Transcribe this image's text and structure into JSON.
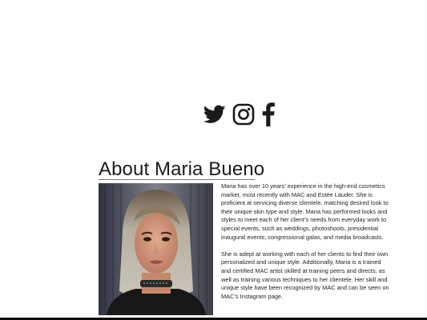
{
  "social": {
    "icons": [
      "twitter-icon",
      "instagram-icon",
      "facebook-icon"
    ],
    "icon_color": "#1b1b1b"
  },
  "about": {
    "title": "About Maria Bueno",
    "paragraphs": [
      "Maria has over 10 years’ experience in the high-end cosmetics market, most recently with MAC and Estée Lauder. She is proficient at servicing diverse clientele, matching desired look to their unique skin type and style. Maria has performed looks and styles to meet each of her client’s needs from everyday work to special events, such as weddings, photoshoots, presidential inaugural events, congressional galas, and media broadcasts.",
      "She is adept at working with each of her clients to find their own personalized and unique style. Additionally, Maria is a trained and certified MAC artist skilled at training peers and directs, as well as training various techniques to her clientele. Her skill and unique style have been recognized by MAC and can be seen on MAC’s Instagram page."
    ]
  },
  "colors": {
    "text": "#1f1f1f",
    "rule": "#7b7b7b",
    "bottom_bar": "#0a0a0a"
  }
}
